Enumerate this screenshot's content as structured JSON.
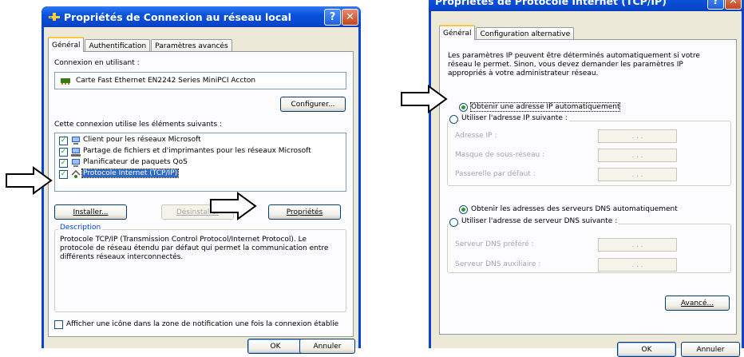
{
  "left_dialog": {
    "title": "Propriétés de Connexion au réseau local",
    "help_symbol": "?",
    "close_symbol": "✕",
    "tabs": [
      "Général",
      "Authentification",
      "Paramètres avancés"
    ],
    "connect_using_label": "Connexion en utilisant :",
    "adapter_name": "Carte Fast Ethernet EN2242 Series MiniPCI Accton",
    "configure_button": "Configurer...",
    "components_label": "Cette connexion utilise les éléments suivants :",
    "components": [
      {
        "label": "Client pour les réseaux Microsoft",
        "checked": true,
        "icon": "network-client-icon"
      },
      {
        "label": "Partage de fichiers et d'imprimantes pour les réseaux Microsoft",
        "checked": true,
        "icon": "file-share-icon"
      },
      {
        "label": "Planificateur de paquets QoS",
        "checked": true,
        "icon": "scheduler-icon"
      },
      {
        "label": "Protocole Internet (TCP/IP)",
        "checked": true,
        "icon": "protocol-icon",
        "selected": true
      }
    ],
    "install_button": "Installer...",
    "uninstall_button": "Désinstaller",
    "properties_button": "Propriétés",
    "description_title": "Description",
    "description_text": "Protocole TCP/IP (Transmission Control Protocol/Internet Protocol). Le protocole de réseau étendu par défaut qui permet la communication entre différents réseaux interconnectés.",
    "notify_checkbox_label": "Afficher une icône dans la zone de notification une fois la connexion établie",
    "notify_checked": false,
    "ok_button": "OK",
    "cancel_button": "Annuler"
  },
  "right_dialog": {
    "title": "Propriétés de Protocole Internet (TCP/IP)",
    "help_symbol": "?",
    "close_symbol": "✕",
    "tabs": [
      "Général",
      "Configuration alternative"
    ],
    "intro_text": "Les paramètres IP peuvent être déterminés automatiquement si votre réseau le permet. Sinon, vous devez demander les paramètres IP appropriés à votre administrateur réseau.",
    "radio_auto_ip": "Obtenir une adresse IP automatiquement",
    "radio_manual_ip": "Utiliser l'adresse IP suivante :",
    "ip_address_label": "Adresse IP :",
    "subnet_label": "Masque de sous-réseau :",
    "gateway_label": "Passerelle par défaut :",
    "radio_auto_dns": "Obtenir les adresses des serveurs DNS automatiquement",
    "radio_manual_dns": "Utiliser l'adresse de serveur DNS suivante :",
    "preferred_dns_label": "Serveur DNS préféré :",
    "alternate_dns_label": "Serveur DNS auxiliaire :",
    "ip_dots": ".   .   .",
    "advanced_button": "Avancé...",
    "ok_button": "OK",
    "cancel_button": "Annuler"
  },
  "colors": {
    "titlebar": "#0a52dc",
    "dialog_bg": "#ece9d8",
    "selection": "#316ac5",
    "group_title": "#0046d5"
  }
}
